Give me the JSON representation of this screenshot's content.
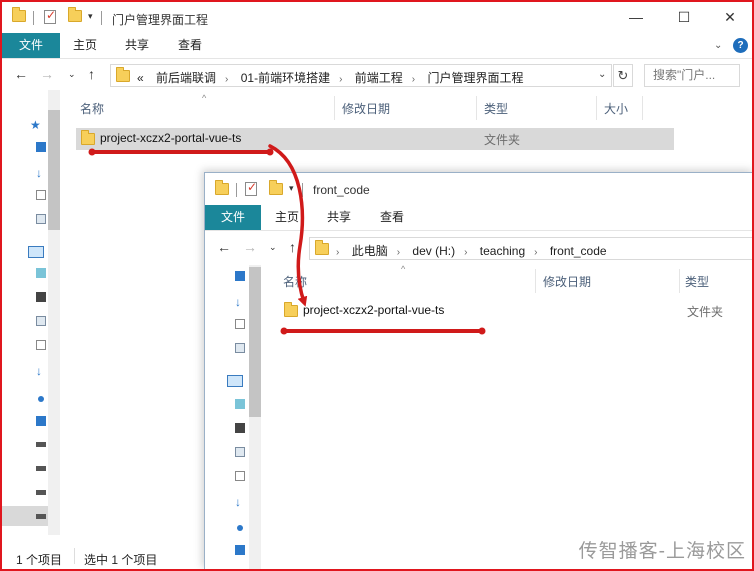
{
  "back_window": {
    "title": "门户管理界面工程",
    "ribbon_tabs": [
      "文件",
      "主页",
      "共享",
      "查看"
    ],
    "breadcrumbs": [
      "«",
      "前后端联调",
      "01-前端环境搭建",
      "前端工程",
      "门户管理界面工程"
    ],
    "search_placeholder": "搜索\"门户...",
    "columns": [
      "名称",
      "修改日期",
      "类型",
      "大小"
    ],
    "rows": [
      {
        "name": "project-xczx2-portal-vue-ts",
        "type": "文件夹",
        "selected": true
      }
    ],
    "status": {
      "count": "1 个项目",
      "selected": "选中 1 个项目"
    }
  },
  "front_window": {
    "title": "front_code",
    "ribbon_tabs": [
      "文件",
      "主页",
      "共享",
      "查看"
    ],
    "breadcrumbs": [
      "此电脑",
      "dev (H:)",
      "teaching",
      "front_code"
    ],
    "columns": [
      "名称",
      "修改日期",
      "类型"
    ],
    "rows": [
      {
        "name": "project-xczx2-portal-vue-ts",
        "type": "文件夹"
      }
    ]
  },
  "window_controls": {
    "minimize": "—",
    "maximize": "☐",
    "close": "✕"
  },
  "watermark": "传智播客-上海校区",
  "colors": {
    "accent_tab": "#1b879a",
    "annotation": "#d01a1a",
    "folder": "#f7cf5a",
    "frame_border": "#e0161e"
  }
}
